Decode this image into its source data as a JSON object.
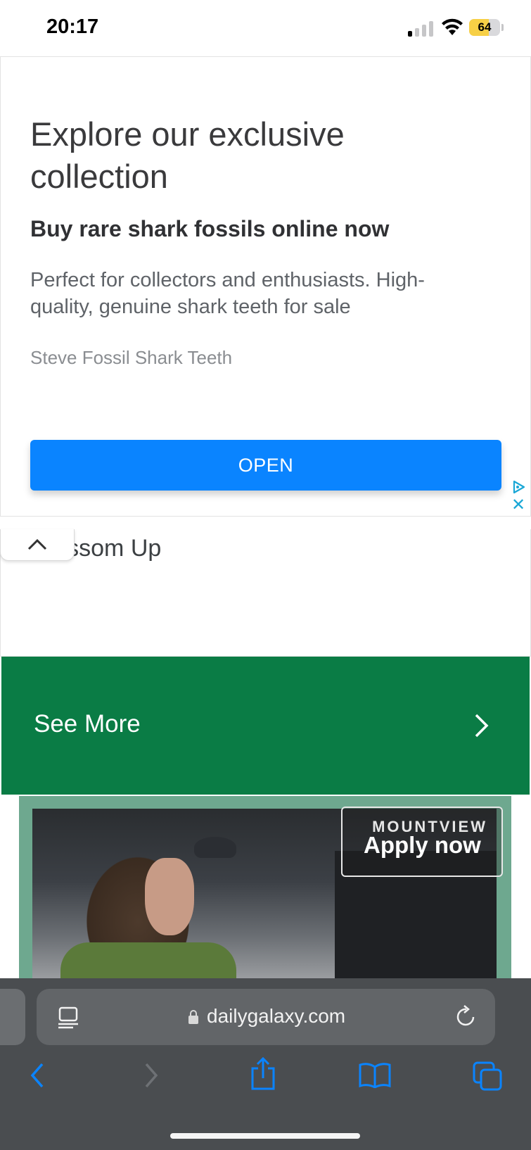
{
  "status_bar": {
    "time": "20:17",
    "battery": "64",
    "battery_level_percent": 64,
    "signal_bars_active": 1,
    "icons": [
      "cellular-signal-icon",
      "wifi-icon",
      "battery-icon"
    ]
  },
  "ad": {
    "heading": "Explore our exclusive collection",
    "subheading": "Buy rare shark fossils online now",
    "description": "Perfect for collectors and enthusiasts. High-quality, genuine shark teeth for sale",
    "advertiser": "Steve Fossil Shark Teeth",
    "cta_label": "OPEN",
    "close_label": "✕",
    "colors": {
      "cta": "#0a84ff",
      "adchoices": "#1aa7d6"
    },
    "icons": [
      "adchoices-icon",
      "close-icon"
    ]
  },
  "collapsed_section": {
    "title": "Blossom Up",
    "toggle_icon": "chevron-up-icon"
  },
  "see_more": {
    "label": "See More",
    "icon": "chevron-right-icon",
    "color": "#0a7c45"
  },
  "image_ad": {
    "brand": "MOUNTVIEW",
    "cta": "Apply now",
    "frame_color": "#6ea88f"
  },
  "browser": {
    "url": "dailygalaxy.com",
    "icons": [
      "reader-icon",
      "lock-icon",
      "reload-icon",
      "back-icon",
      "forward-icon",
      "share-icon",
      "bookmarks-icon",
      "tabs-icon"
    ]
  }
}
